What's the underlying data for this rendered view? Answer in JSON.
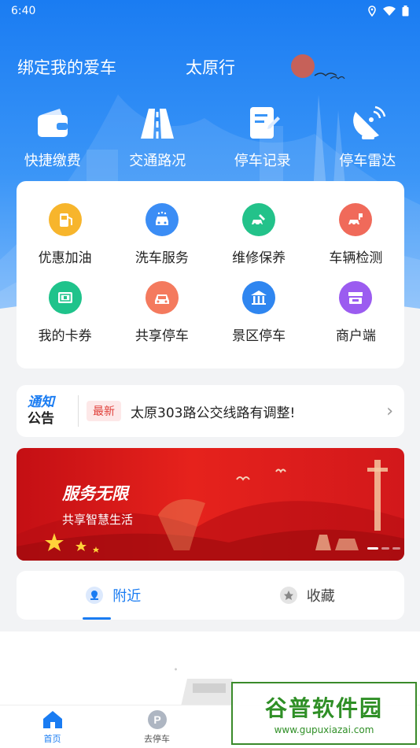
{
  "status_bar": {
    "time": "6:40"
  },
  "header": {
    "bind_car": "绑定我的爱车",
    "city": "太原行"
  },
  "quick_actions": [
    {
      "label": "快捷缴费",
      "icon": "wallet-icon"
    },
    {
      "label": "交通路况",
      "icon": "road-icon"
    },
    {
      "label": "停车记录",
      "icon": "record-icon"
    },
    {
      "label": "停车雷达",
      "icon": "radar-icon"
    }
  ],
  "services": [
    {
      "label": "优惠加油",
      "icon": "fuel-icon",
      "color": "#f7b52c"
    },
    {
      "label": "洗车服务",
      "icon": "car-wash-icon",
      "color": "#3b8df5"
    },
    {
      "label": "维修保养",
      "icon": "repair-icon",
      "color": "#23c28a"
    },
    {
      "label": "车辆检测",
      "icon": "inspection-icon",
      "color": "#f06a5a"
    },
    {
      "label": "我的卡券",
      "icon": "coupon-icon",
      "color": "#1fc38b"
    },
    {
      "label": "共享停车",
      "icon": "shared-parking-icon",
      "color": "#f47a5e"
    },
    {
      "label": "景区停车",
      "icon": "scenic-parking-icon",
      "color": "#2f86f0"
    },
    {
      "label": "商户端",
      "icon": "merchant-icon",
      "color": "#9b5cf0"
    }
  ],
  "notice": {
    "logo_line1": "通知",
    "logo_line2": "公告",
    "badge": "最新",
    "text": "太原303路公交线路有调整!"
  },
  "banner": {
    "title": "服务无限",
    "subtitle": "共享智慧生活"
  },
  "tabs": [
    {
      "label": "附近",
      "active": true
    },
    {
      "label": "收藏",
      "active": false
    }
  ],
  "bottom_nav": [
    {
      "label": "首页",
      "active": true
    },
    {
      "label": "去停车",
      "active": false
    }
  ],
  "watermark": {
    "main": "谷普软件园",
    "url": "www.gupuxiazai.com"
  },
  "colors": {
    "primary": "#1a7cf2",
    "badge_red": "#e0403a",
    "banner_red": "#d2181b"
  }
}
